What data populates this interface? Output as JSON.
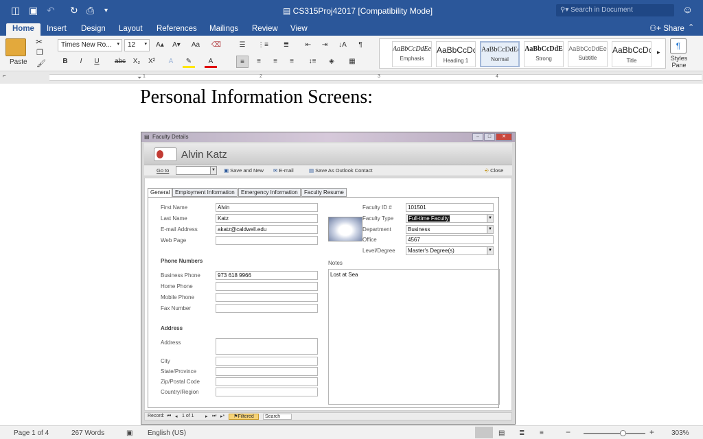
{
  "app": {
    "document_title": "CS315Proj42017 [Compatibility Mode]",
    "search_placeholder": "Search in Document",
    "share_label": "Share"
  },
  "ribbon_tabs": [
    "Home",
    "Insert",
    "Design",
    "Layout",
    "References",
    "Mailings",
    "Review",
    "View"
  ],
  "home": {
    "paste_label": "Paste",
    "font_name": "Times New Ro...",
    "font_size": "12",
    "styles": [
      {
        "sample": "AaBbCcDdEe",
        "name": "Emphasis"
      },
      {
        "sample": "AaBbCcDc",
        "name": "Heading 1"
      },
      {
        "sample": "AaBbCcDdEe",
        "name": "Normal"
      },
      {
        "sample": "AaBbCcDdE",
        "name": "Strong"
      },
      {
        "sample": "AaBbCcDdEe",
        "name": "Subtitle"
      },
      {
        "sample": "AaBbCcDc",
        "name": "Title"
      }
    ],
    "styles_pane_label": "Styles Pane"
  },
  "ruler": {
    "marks": [
      "1",
      "2",
      "3",
      "4"
    ]
  },
  "document": {
    "heading": "Personal Information Screens:"
  },
  "access": {
    "window_title": "Faculty Details",
    "full_name": "Alvin Katz",
    "toolbar": {
      "goto": "Go to",
      "save_new": "Save and New",
      "email": "E-mail",
      "save_outlook": "Save As Outlook Contact",
      "close": "Close"
    },
    "tabs": [
      "General",
      "Employment Information",
      "Emergency Information",
      "Faculty Resume"
    ],
    "labels": {
      "first_name": "First Name",
      "last_name": "Last Name",
      "email": "E-mail Address",
      "web_page": "Web Page",
      "phone_numbers": "Phone Numbers",
      "business_phone": "Business Phone",
      "home_phone": "Home Phone",
      "mobile_phone": "Mobile Phone",
      "fax_number": "Fax Number",
      "address_section": "Address",
      "address": "Address",
      "city": "City",
      "state": "State/Province",
      "zip": "Zip/Postal Code",
      "country": "Country/Region",
      "faculty_id": "Faculty ID #",
      "faculty_type": "Faculty Type",
      "department": "Department",
      "office": "Office",
      "level_degree": "Level/Degree",
      "notes": "Notes"
    },
    "values": {
      "first_name": "Alvin",
      "last_name": "Katz",
      "email": "akatz@caldwell.edu",
      "web_page": "",
      "business_phone": "973 618 9966",
      "faculty_id": "101501",
      "faculty_type": "Full-time Faculty",
      "department": "Business",
      "office": "4567",
      "level_degree": "Master's Degree(s)",
      "notes": "Lost at Sea"
    },
    "record_nav": {
      "record_label": "Record:",
      "position": "1 of 1",
      "filter": "Filtered",
      "search": "Search"
    }
  },
  "status": {
    "page": "Page 1 of 4",
    "words": "267 Words",
    "language": "English (US)",
    "zoom": "303%",
    "zoom_fraction": 0.63
  }
}
